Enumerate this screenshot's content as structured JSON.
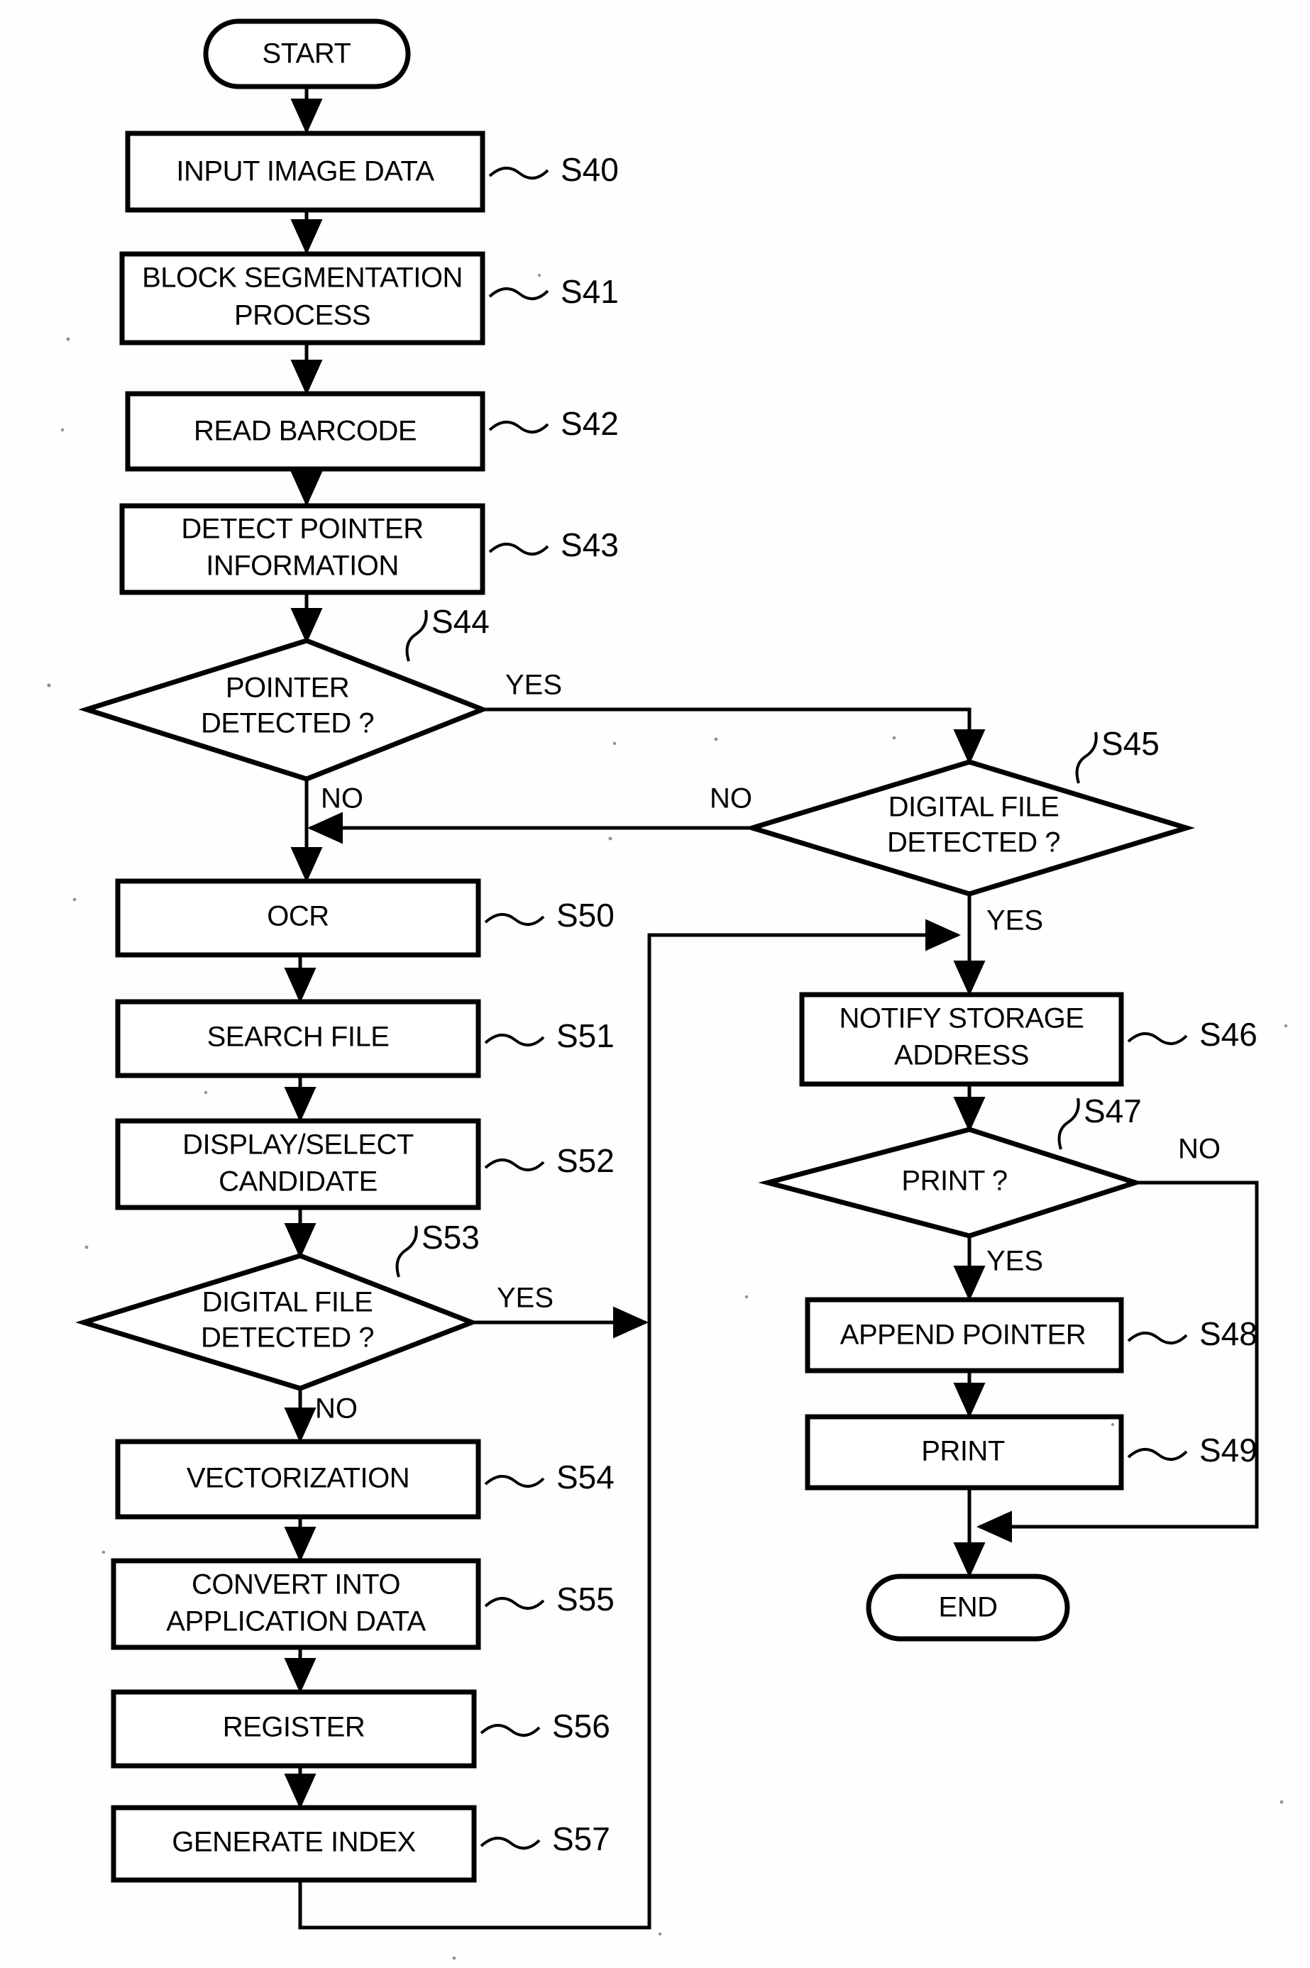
{
  "diagram": {
    "type": "flowchart",
    "title": "",
    "terminals": {
      "start": "START",
      "end": "END"
    },
    "branch_labels": {
      "yes": "YES",
      "no": "NO"
    },
    "nodes": [
      {
        "id": "start",
        "shape": "terminator",
        "text": "START",
        "step": ""
      },
      {
        "id": "s40",
        "shape": "process",
        "text": "INPUT IMAGE DATA",
        "step": "S40"
      },
      {
        "id": "s41",
        "shape": "process",
        "text": "BLOCK SEGMENTATION\nPROCESS",
        "step": "S41"
      },
      {
        "id": "s42",
        "shape": "process",
        "text": "READ BARCODE",
        "step": "S42"
      },
      {
        "id": "s43",
        "shape": "process",
        "text": "DETECT POINTER\nINFORMATION",
        "step": "S43"
      },
      {
        "id": "s44",
        "shape": "decision",
        "text": "POINTER\nDETECTED ?",
        "step": "S44"
      },
      {
        "id": "s45",
        "shape": "decision",
        "text": "DIGITAL FILE\nDETECTED ?",
        "step": "S45"
      },
      {
        "id": "s46",
        "shape": "process",
        "text": "NOTIFY STORAGE\nADDRESS",
        "step": "S46"
      },
      {
        "id": "s47",
        "shape": "decision",
        "text": "PRINT ?",
        "step": "S47"
      },
      {
        "id": "s48",
        "shape": "process",
        "text": "APPEND POINTER",
        "step": "S48"
      },
      {
        "id": "s49",
        "shape": "process",
        "text": "PRINT",
        "step": "S49"
      },
      {
        "id": "s50",
        "shape": "process",
        "text": "OCR",
        "step": "S50"
      },
      {
        "id": "s51",
        "shape": "process",
        "text": "SEARCH FILE",
        "step": "S51"
      },
      {
        "id": "s52",
        "shape": "process",
        "text": "DISPLAY/SELECT\nCANDIDATE",
        "step": "S52"
      },
      {
        "id": "s53",
        "shape": "decision",
        "text": "DIGITAL FILE\nDETECTED ?",
        "step": "S53"
      },
      {
        "id": "s54",
        "shape": "process",
        "text": "VECTORIZATION",
        "step": "S54"
      },
      {
        "id": "s55",
        "shape": "process",
        "text": "CONVERT INTO\nAPPLICATION DATA",
        "step": "S55"
      },
      {
        "id": "s56",
        "shape": "process",
        "text": "REGISTER",
        "step": "S56"
      },
      {
        "id": "s57",
        "shape": "process",
        "text": "GENERATE INDEX",
        "step": "S57"
      },
      {
        "id": "end",
        "shape": "terminator",
        "text": "END",
        "step": ""
      }
    ],
    "edges": [
      {
        "from": "start",
        "to": "s40",
        "label": ""
      },
      {
        "from": "s40",
        "to": "s41",
        "label": ""
      },
      {
        "from": "s41",
        "to": "s42",
        "label": ""
      },
      {
        "from": "s42",
        "to": "s43",
        "label": ""
      },
      {
        "from": "s43",
        "to": "s44",
        "label": ""
      },
      {
        "from": "s44",
        "to": "s45",
        "label": "YES"
      },
      {
        "from": "s44",
        "to": "s50",
        "label": "NO"
      },
      {
        "from": "s45",
        "to": "s44_no_path",
        "label": "NO"
      },
      {
        "from": "s45",
        "to": "s46",
        "label": "YES"
      },
      {
        "from": "s46",
        "to": "s47",
        "label": ""
      },
      {
        "from": "s47",
        "to": "s48",
        "label": "YES"
      },
      {
        "from": "s47",
        "to": "end",
        "label": "NO"
      },
      {
        "from": "s48",
        "to": "s49",
        "label": ""
      },
      {
        "from": "s49",
        "to": "end",
        "label": ""
      },
      {
        "from": "s50",
        "to": "s51",
        "label": ""
      },
      {
        "from": "s51",
        "to": "s52",
        "label": ""
      },
      {
        "from": "s52",
        "to": "s53",
        "label": ""
      },
      {
        "from": "s53",
        "to": "s45_yes_junction",
        "label": "YES"
      },
      {
        "from": "s53",
        "to": "s54",
        "label": "NO"
      },
      {
        "from": "s54",
        "to": "s55",
        "label": ""
      },
      {
        "from": "s55",
        "to": "s56",
        "label": ""
      },
      {
        "from": "s56",
        "to": "s57",
        "label": ""
      },
      {
        "from": "s57",
        "to": "s45_yes_junction",
        "label": ""
      }
    ],
    "labels": {
      "start": "START",
      "end": "END",
      "s40": "INPUT IMAGE DATA",
      "s41_line1": "BLOCK SEGMENTATION",
      "s41_line2": "PROCESS",
      "s42": "READ BARCODE",
      "s43_line1": "DETECT POINTER",
      "s43_line2": "INFORMATION",
      "s44_line1": "POINTER",
      "s44_line2": "DETECTED ?",
      "s45_line1": "DIGITAL FILE",
      "s45_line2": "DETECTED ?",
      "s46_line1": "NOTIFY STORAGE",
      "s46_line2": "ADDRESS",
      "s47": "PRINT ?",
      "s48": "APPEND POINTER",
      "s49": "PRINT",
      "s50": "OCR",
      "s51": "SEARCH FILE",
      "s52_line1": "DISPLAY/SELECT",
      "s52_line2": "CANDIDATE",
      "s53_line1": "DIGITAL FILE",
      "s53_line2": "DETECTED ?",
      "s54": "VECTORIZATION",
      "s55_line1": "CONVERT INTO",
      "s55_line2": "APPLICATION DATA",
      "s56": "REGISTER",
      "s57": "GENERATE INDEX"
    },
    "steps": {
      "s40": "S40",
      "s41": "S41",
      "s42": "S42",
      "s43": "S43",
      "s44": "S44",
      "s45": "S45",
      "s46": "S46",
      "s47": "S47",
      "s48": "S48",
      "s49": "S49",
      "s50": "S50",
      "s51": "S51",
      "s52": "S52",
      "s53": "S53",
      "s54": "S54",
      "s55": "S55",
      "s56": "S56",
      "s57": "S57"
    },
    "branches": {
      "s44_yes": "YES",
      "s44_no": "NO",
      "s45_no": "NO",
      "s45_yes": "YES",
      "s47_no": "NO",
      "s47_yes": "YES",
      "s53_yes": "YES",
      "s53_no": "NO"
    },
    "colors": {
      "stroke": "#000000",
      "fill": "#ffffff",
      "background": "#fefefe"
    }
  }
}
